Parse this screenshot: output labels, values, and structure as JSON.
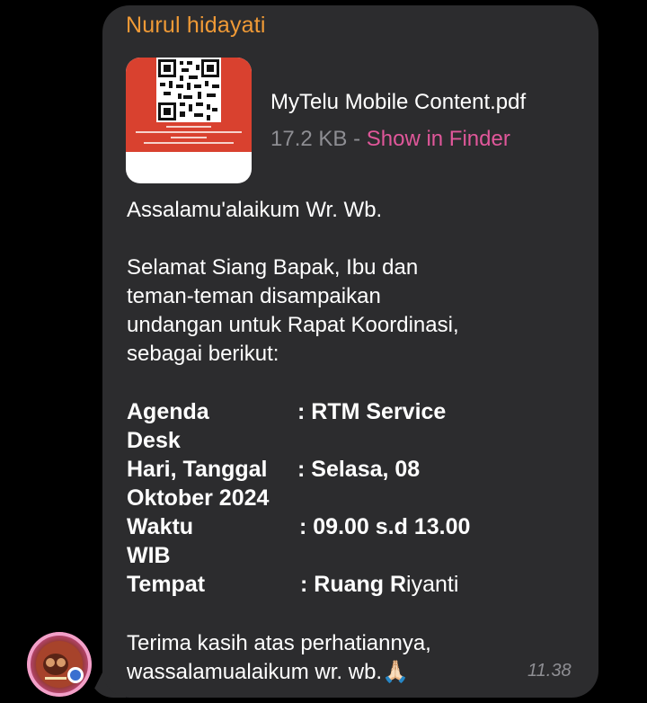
{
  "chat": {
    "sender_name": "Nurul hidayati",
    "timestamp": "11.38"
  },
  "attachment": {
    "file_name": "MyTelu Mobile Content.pdf",
    "file_size": "17.2 KB",
    "separator": " - ",
    "action_label": "Show in Finder",
    "thumbnail_icon": "pdf-thumbnail-qr-icon"
  },
  "message": {
    "greeting": "Assalamu'alaikum Wr. Wb.",
    "body_line_1": "Selamat Siang Bapak, Ibu dan",
    "body_line_2": "teman-teman disampaikan",
    "body_line_3": "undangan untuk Rapat Koordinasi,",
    "body_line_4": "sebagai berikut:",
    "agenda_label": "Agenda",
    "agenda_value": ": RTM Service",
    "agenda_value_cont": "Desk",
    "date_label": "Hari, Tanggal",
    "date_value": ": Selasa, 08",
    "date_value_cont": "Oktober 2024",
    "time_label": "Waktu",
    "time_value": ": 09.00 s.d 13.00",
    "time_value_cont": "WIB",
    "place_label": "Tempat",
    "place_value_bold": ": Ruang R",
    "place_value_rest": "iyanti",
    "closing_line_1": "Terima kasih atas perhatiannya,",
    "closing_line_2": "wassalamualaikum wr. wb.",
    "closing_emoji": "🙏🏻"
  },
  "colors": {
    "sender": "#f09a36",
    "link": "#e0579a",
    "bubble": "#2c2c2e",
    "meta": "#8e8e93"
  }
}
